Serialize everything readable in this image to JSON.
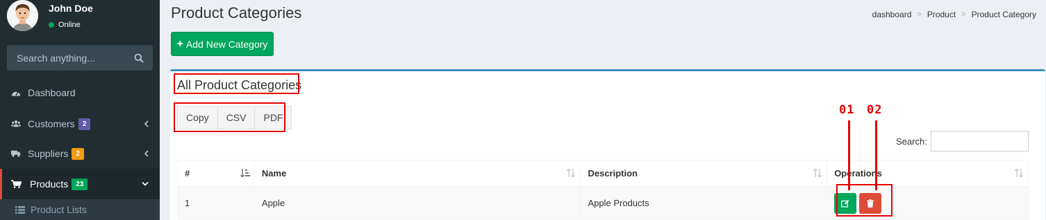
{
  "sidebar": {
    "user": {
      "name": "John Doe",
      "status": "Online"
    },
    "search": {
      "placeholder": "Search anything..."
    },
    "items": [
      {
        "label": "Dashboard",
        "icon": "dashboard-icon"
      },
      {
        "label": "Customers",
        "icon": "users-icon",
        "badge": "2",
        "badge_color": "#605ca8"
      },
      {
        "label": "Suppliers",
        "icon": "truck-icon",
        "badge": "2",
        "badge_color": "#f39c12"
      },
      {
        "label": "Products",
        "icon": "cart-icon",
        "badge": "23",
        "badge_color": "#00a65a"
      }
    ],
    "submenu": [
      {
        "label": "Product Lists",
        "icon": "list-icon"
      }
    ]
  },
  "header": {
    "title": "Product Categories",
    "breadcrumb": [
      "dashboard",
      "Product",
      "Product Category"
    ]
  },
  "toolbar": {
    "add_label": "Add New Category"
  },
  "box": {
    "title": "All Product Categories",
    "export_buttons": [
      "Copy",
      "CSV",
      "PDF"
    ],
    "search_label": "Search:"
  },
  "table": {
    "columns": [
      "#",
      "Name",
      "Description",
      "Operations"
    ],
    "rows": [
      {
        "num": "1",
        "name": "Apple",
        "description": "Apple Products"
      }
    ]
  },
  "annotations": {
    "marker_1": "01",
    "marker_2": "02",
    "color": "#e60000"
  },
  "colors": {
    "sidebar": "#222d32",
    "accent": "#3c8dbc",
    "success": "#00a65a",
    "danger": "#dd4b39"
  }
}
